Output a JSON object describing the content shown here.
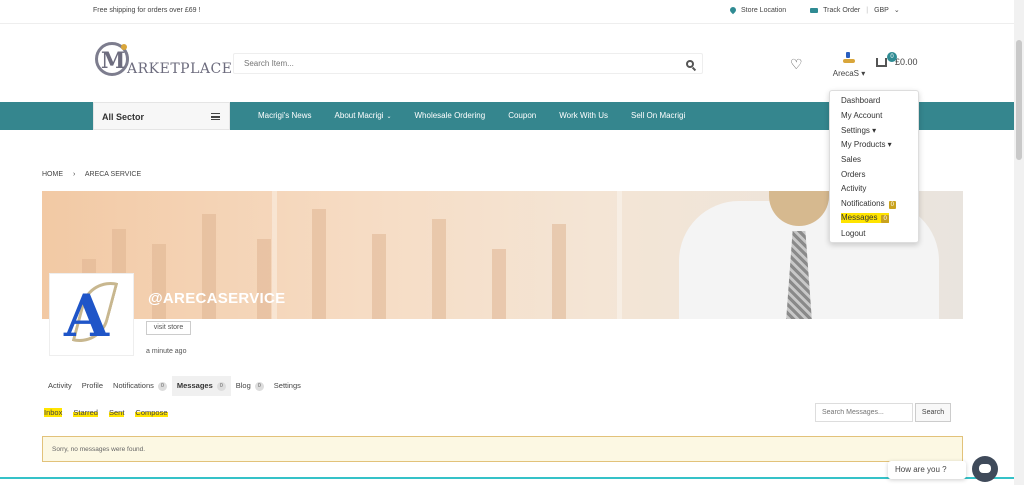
{
  "topbar": {
    "shipping": "Free shipping for orders over £69 !",
    "store_location": "Store Location",
    "track_order": "Track Order",
    "currency": "GBP",
    "currency_caret": "⌄"
  },
  "header": {
    "logo_m": "M",
    "logo_word": "ARKETPLACE",
    "search_placeholder": "Search Item...",
    "heart_glyph": "♡",
    "username": "ArecaS",
    "user_caret": "▾",
    "cart_count": "0",
    "cart_total": "£0.00"
  },
  "nav": {
    "sector_label": "All Sector",
    "items": [
      "Macrigi's News",
      "About Macrigi",
      "Wholesale Ordering",
      "Coupon",
      "Work With Us",
      "Sell On Macrigi"
    ],
    "about_caret": "⌄"
  },
  "dropdown": {
    "dashboard": "Dashboard",
    "my_account": "My Account",
    "settings": "Settings ▾",
    "my_products": "My Products ▾",
    "sales": "Sales",
    "orders": "Orders",
    "activity": "Activity",
    "notifications": "Notifications",
    "notifications_count": "0",
    "messages": "Messages",
    "messages_count": "0",
    "logout": "Logout"
  },
  "breadcrumb": {
    "home": "HOME",
    "separator": "›",
    "current": "ARECA SERVICE"
  },
  "profile": {
    "handle": "@ARECASERVICE",
    "visit_store": "visit store",
    "last_seen": "a minute ago",
    "avatar_letter": "A"
  },
  "tabs": {
    "activity": "Activity",
    "profile": "Profile",
    "notifications": "Notifications",
    "notifications_count": "0",
    "messages": "Messages",
    "messages_count": "0",
    "blog": "Blog",
    "blog_count": "0",
    "settings": "Settings"
  },
  "subtabs": {
    "inbox": "Inbox",
    "starred": "Starred",
    "sent": "Sent",
    "compose": "Compose"
  },
  "messages_search": {
    "placeholder": "Search Messages...",
    "button": "Search"
  },
  "alert": {
    "text": "Sorry, no messages were found."
  },
  "chat": {
    "prompt": "How are you ?"
  },
  "colors": {
    "nav_teal": "#35868e",
    "highlight_yellow": "#ffe400",
    "count_gold": "#c9a21e",
    "alert_bg": "#fcf8e3"
  }
}
